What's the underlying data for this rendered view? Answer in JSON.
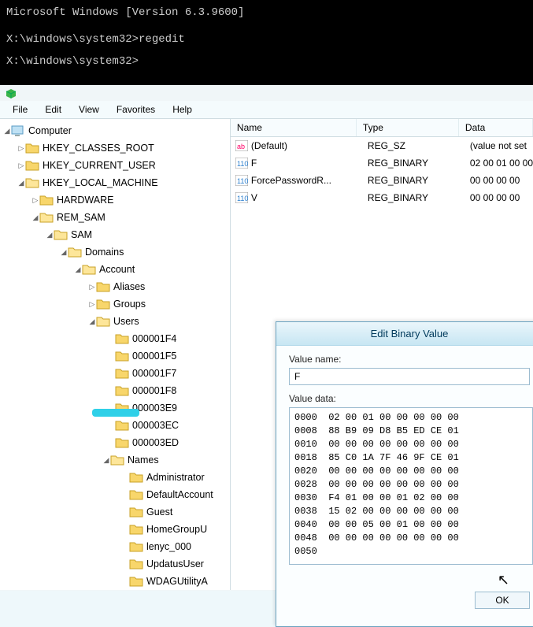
{
  "cmd": {
    "line1": "Microsoft Windows [Version 6.3.9600]",
    "line2": "X:\\windows\\system32>regedit",
    "line3": "X:\\windows\\system32>"
  },
  "menu": {
    "file": "File",
    "edit": "Edit",
    "view": "View",
    "favorites": "Favorites",
    "help": "Help"
  },
  "tree": {
    "computer": "Computer",
    "hkcr": "HKEY_CLASSES_ROOT",
    "hkcu": "HKEY_CURRENT_USER",
    "hklm": "HKEY_LOCAL_MACHINE",
    "hardware": "HARDWARE",
    "rem_sam": "REM_SAM",
    "sam": "SAM",
    "domains": "Domains",
    "account": "Account",
    "aliases": "Aliases",
    "groups": "Groups",
    "users": "Users",
    "u0": "000001F4",
    "u1": "000001F5",
    "u2": "000001F7",
    "u3": "000001F8",
    "u4": "000003E9",
    "u5": "000003EC",
    "u6": "000003ED",
    "names": "Names",
    "n0": "Administrator",
    "n1": "DefaultAccount",
    "n2": "Guest",
    "n3": "HomeGroupU",
    "n4": "lenyc_000",
    "n5": "UpdatusUser",
    "n6": "WDAGUtilityA"
  },
  "cols": {
    "name": "Name",
    "type": "Type",
    "data": "Data"
  },
  "rows": [
    {
      "name": "(Default)",
      "type": "REG_SZ",
      "data": "(value not set"
    },
    {
      "name": "F",
      "type": "REG_BINARY",
      "data": "02 00 01 00 00"
    },
    {
      "name": "ForcePasswordR...",
      "type": "REG_BINARY",
      "data": "00 00 00 00"
    },
    {
      "name": "V",
      "type": "REG_BINARY",
      "data": "00 00 00 00"
    }
  ],
  "dialog": {
    "title": "Edit Binary Value",
    "valueNameLabel": "Value name:",
    "valueName": "F",
    "valueDataLabel": "Value data:",
    "hex": "0000  02 00 01 00 00 00 00 00\n0008  88 B9 09 D8 B5 ED CE 01\n0010  00 00 00 00 00 00 00 00\n0018  85 C0 1A 7F 46 9F CE 01\n0020  00 00 00 00 00 00 00 00\n0028  00 00 00 00 00 00 00 00\n0030  F4 01 00 00 01 02 00 00\n0038  15 02 00 00 00 00 00 00\n0040  00 00 05 00 01 00 00 00\n0048  00 00 00 00 00 00 00 00\n0050",
    "ok": "OK"
  }
}
